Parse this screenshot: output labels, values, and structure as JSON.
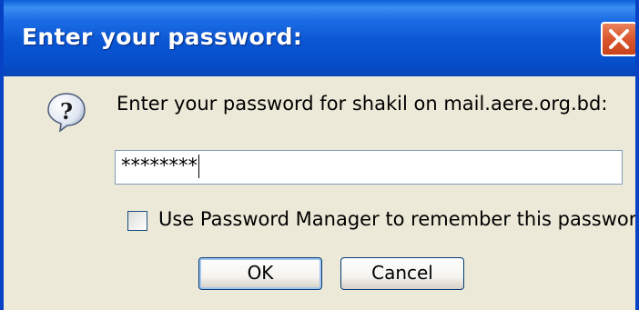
{
  "dialog": {
    "title": "Enter your password:",
    "prompt": "Enter your password for shakil on mail.aere.org.bd:",
    "password_value": "********",
    "remember_label": "Use Password Manager to remember this password.",
    "remember_checked": false,
    "ok_label": "OK",
    "cancel_label": "Cancel",
    "icons": {
      "close": "close-icon",
      "question": "question-icon"
    },
    "colors": {
      "titlebar": "#0a55d2",
      "close_button": "#dd5a30",
      "dialog_background": "#ece9d8"
    }
  }
}
